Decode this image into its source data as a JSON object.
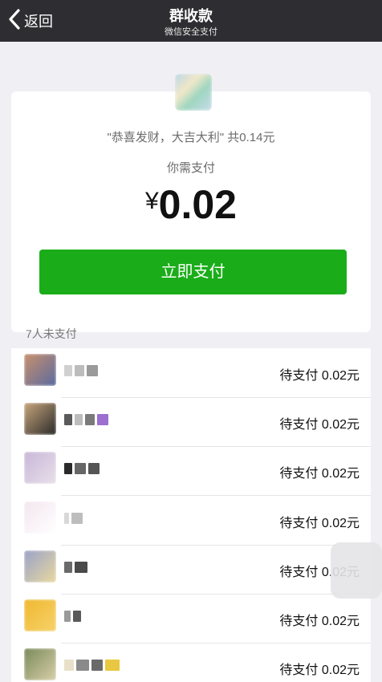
{
  "nav": {
    "back_label": "返回",
    "title": "群收款",
    "subtitle": "微信安全支付"
  },
  "card": {
    "greeting": "\"恭喜发财，大吉大利\" 共0.14元",
    "need_pay_label": "你需支付",
    "currency": "¥",
    "amount": "0.02",
    "pay_button": "立即支付"
  },
  "unpaid_header": "7人未支付",
  "members": [
    {
      "status": "待支付 0.02元",
      "avatar_colors": [
        "#c9906c",
        "#5a6aa0"
      ]
    },
    {
      "status": "待支付 0.02元",
      "avatar_colors": [
        "#c8a67c",
        "#2a2a2a"
      ]
    },
    {
      "status": "待支付 0.02元",
      "avatar_colors": [
        "#c9b6d8",
        "#e8e0ea"
      ]
    },
    {
      "status": "待支付 0.02元",
      "avatar_colors": [
        "#f3e6ef",
        "#ffffff"
      ]
    },
    {
      "status": "待支付 0.02元",
      "avatar_colors": [
        "#9aa2c8",
        "#e8d9a0"
      ]
    },
    {
      "status": "待支付 0.02元",
      "avatar_colors": [
        "#f0b830",
        "#f6d26a"
      ]
    },
    {
      "status": "待支付 0.02元",
      "avatar_colors": [
        "#7a8a5a",
        "#d8cfa8"
      ]
    }
  ],
  "colors": {
    "nav_bg": "#2e2e32",
    "accent": "#1aad19",
    "page_bg": "#efeff4"
  }
}
